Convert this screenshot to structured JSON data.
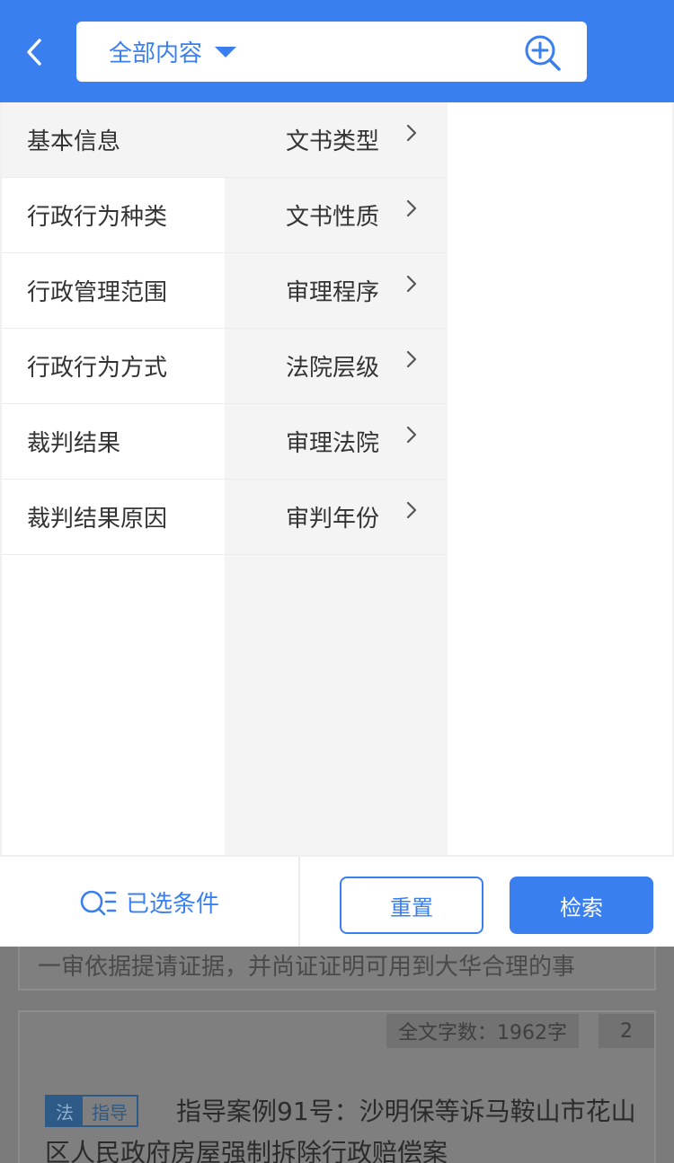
{
  "header": {
    "scope_label": "全部内容",
    "icons": {
      "back": "back-icon",
      "scope": "caret-down-icon",
      "search": "zoom-plus-icon"
    }
  },
  "filters": {
    "categories": [
      {
        "label": "基本信息",
        "active": true
      },
      {
        "label": "行政行为种类",
        "active": false
      },
      {
        "label": "行政管理范围",
        "active": false
      },
      {
        "label": "行政行为方式",
        "active": false
      },
      {
        "label": "裁判结果",
        "active": false
      },
      {
        "label": "裁判结果原因",
        "active": false
      }
    ],
    "subcategories": [
      {
        "label": "文书类型"
      },
      {
        "label": "文书性质"
      },
      {
        "label": "审理程序"
      },
      {
        "label": "法院层级"
      },
      {
        "label": "审理法院"
      },
      {
        "label": "审判年份"
      }
    ]
  },
  "footer": {
    "selected_label": "已选条件",
    "reset_label": "重置",
    "search_label": "检索"
  },
  "results": {
    "partial_text": "一审依据提请证据，并尚证证明可用到大华合理的事",
    "card": {
      "word_count": "全文字数：1962字",
      "rank": "2",
      "tag_type": "法",
      "tag_label": "指导",
      "title": "指导案例91号：沙明保等诉马鞍山市花山区人民政府房屋强制拆除行政赔偿案"
    }
  },
  "colors": {
    "primary": "#3a7ff0",
    "overlay": "#7b7b7b"
  }
}
